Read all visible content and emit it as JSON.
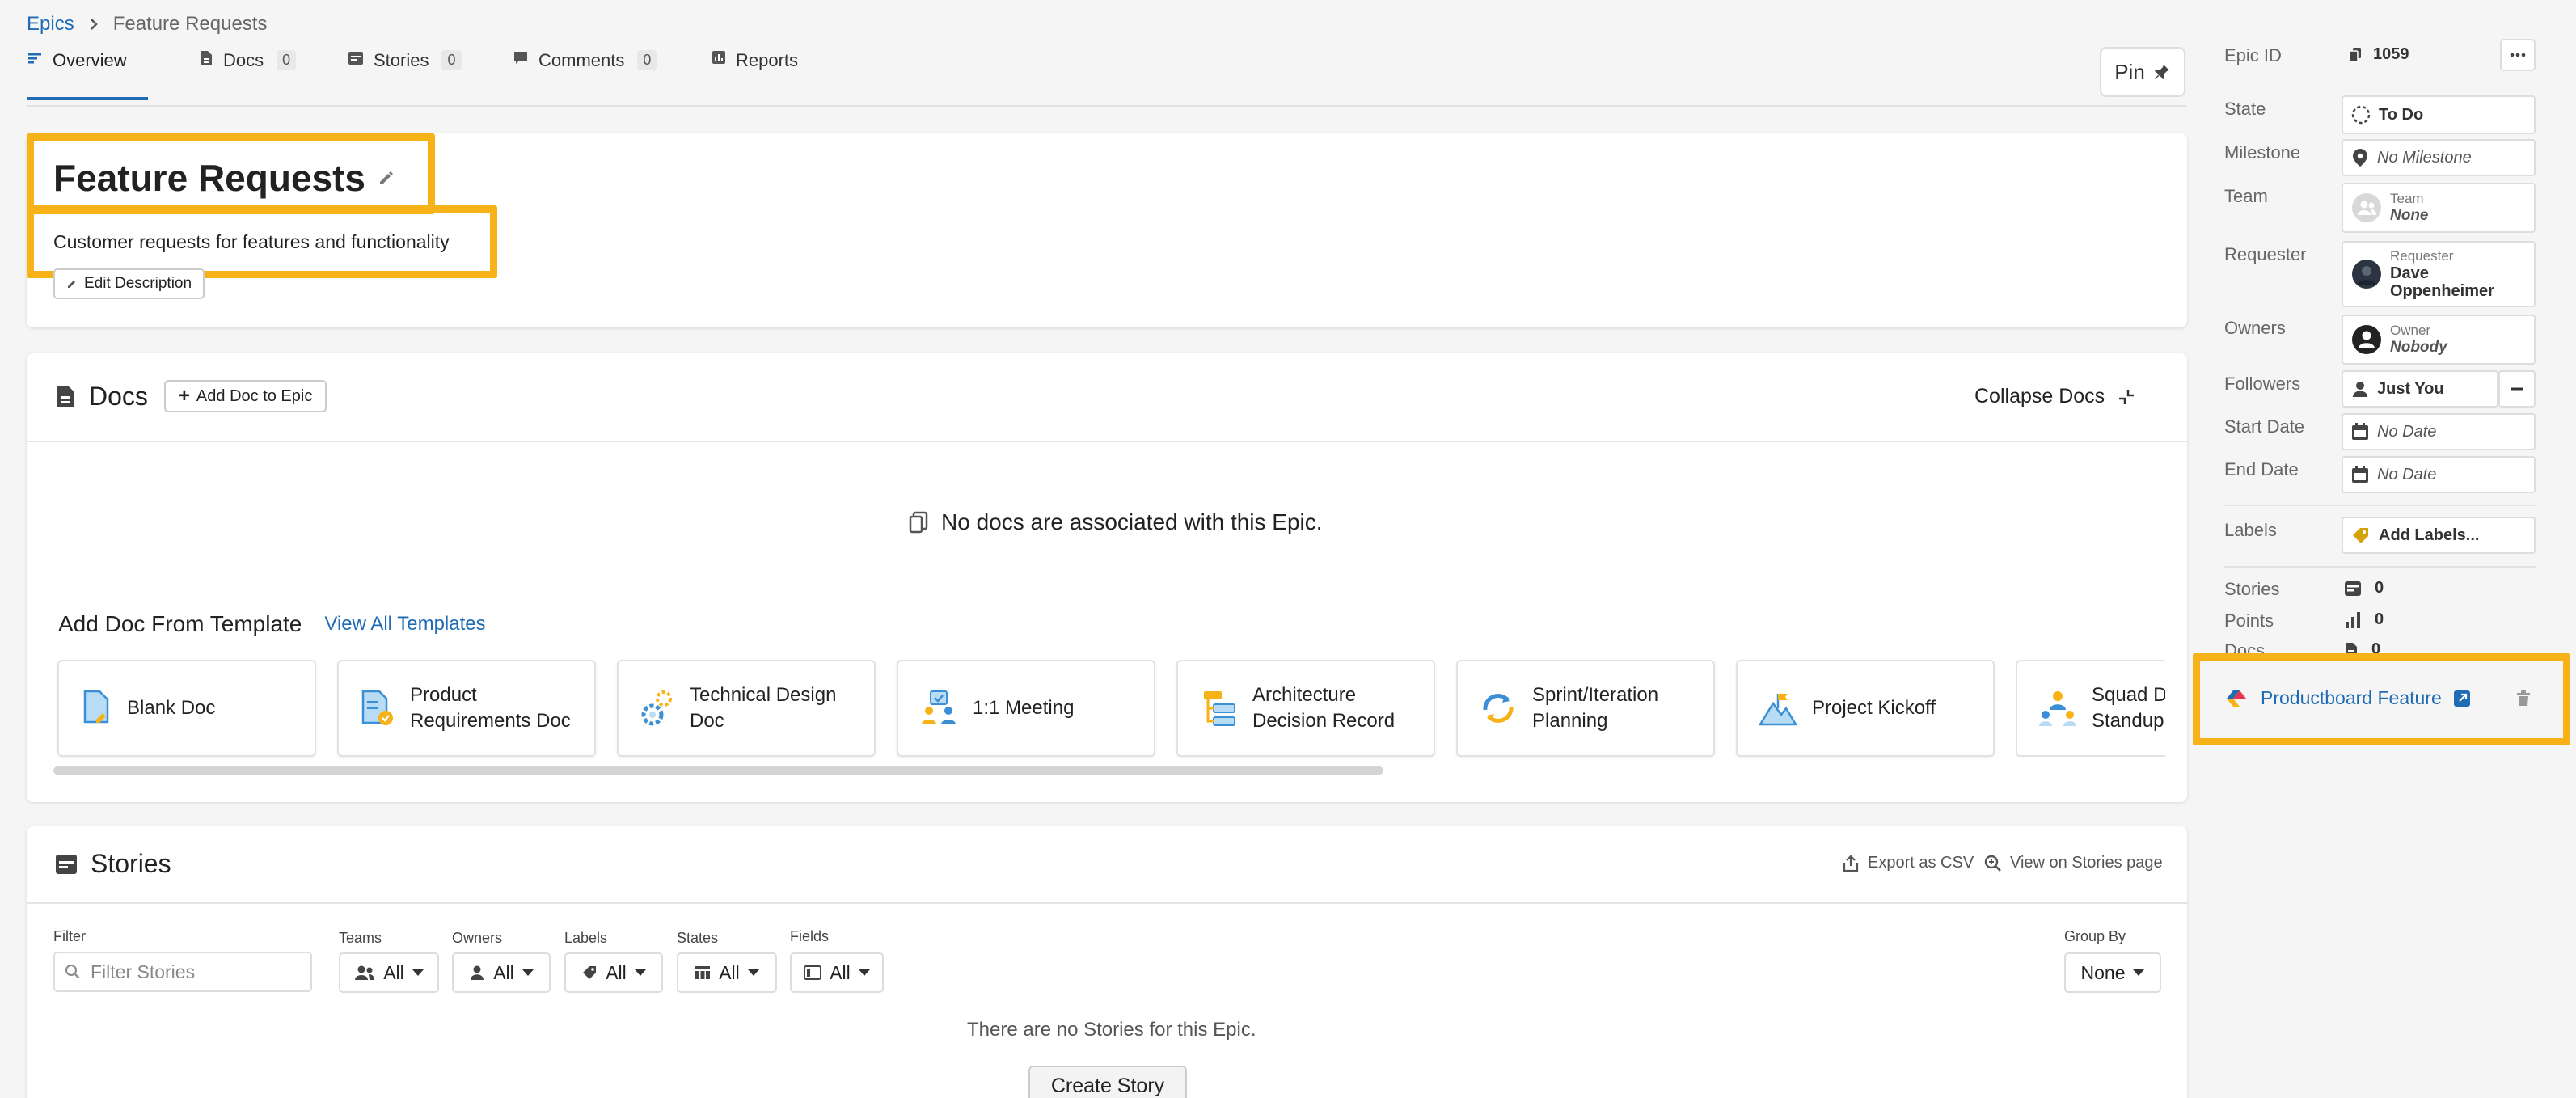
{
  "breadcrumb": {
    "parent": "Epics",
    "current": "Feature Requests"
  },
  "tabs": [
    {
      "label": "Overview"
    },
    {
      "label": "Docs",
      "count": "0"
    },
    {
      "label": "Stories",
      "count": "0"
    },
    {
      "label": "Comments",
      "count": "0"
    },
    {
      "label": "Reports"
    }
  ],
  "pin_label": "Pin",
  "epic": {
    "title": "Feature Requests",
    "description": "Customer requests for features and functionality",
    "edit_description": "Edit Description"
  },
  "docs": {
    "title": "Docs",
    "add_doc": "Add Doc to Epic",
    "collapse": "Collapse Docs",
    "empty": "No docs are associated with this Epic.",
    "template_heading": "Add Doc From Template",
    "view_all": "View All Templates",
    "templates": [
      {
        "line1": "Blank Doc",
        "line2": ""
      },
      {
        "line1": "Product",
        "line2": "Requirements Doc"
      },
      {
        "line1": "Technical Design",
        "line2": "Doc"
      },
      {
        "line1": "1:1 Meeting",
        "line2": ""
      },
      {
        "line1": "Architecture",
        "line2": "Decision Record"
      },
      {
        "line1": "Sprint/Iteration",
        "line2": "Planning"
      },
      {
        "line1": "Project Kickoff",
        "line2": ""
      },
      {
        "line1": "Squad Da",
        "line2": "Standup"
      }
    ]
  },
  "stories": {
    "title": "Stories",
    "export": "Export as CSV",
    "view_on_page": "View on Stories page",
    "filter_label": "Filter",
    "filter_placeholder": "Filter Stories",
    "teams_label": "Teams",
    "teams_value": "All",
    "owners_label": "Owners",
    "owners_value": "All",
    "labels_label": "Labels",
    "labels_value": "All",
    "states_label": "States",
    "states_value": "All",
    "fields_label": "Fields",
    "fields_value": "All",
    "groupby_label": "Group By",
    "groupby_value": "None",
    "empty": "There are no Stories for this Epic.",
    "create": "Create Story"
  },
  "sidebar": {
    "epic_id_label": "Epic ID",
    "epic_id": "1059",
    "state_label": "State",
    "state_value": "To Do",
    "milestone_label": "Milestone",
    "milestone_value": "No Milestone",
    "team_label": "Team",
    "team_sub": "Team",
    "team_value": "None",
    "requester_label": "Requester",
    "requester_sub": "Requester",
    "requester_value_1": "Dave",
    "requester_value_2": "Oppenheimer",
    "owners_label": "Owners",
    "owner_sub": "Owner",
    "owner_value": "Nobody",
    "followers_label": "Followers",
    "followers_value": "Just You",
    "start_label": "Start Date",
    "start_value": "No Date",
    "end_label": "End Date",
    "end_value": "No Date",
    "labels_label": "Labels",
    "labels_value": "Add Labels...",
    "stories_label": "Stories",
    "stories_value": "0",
    "points_label": "Points",
    "points_value": "0",
    "docs_label": "Docs",
    "docs_value": "0",
    "integration_label": "Productboard Feature"
  },
  "colors": {
    "accent": "#1f6cb5",
    "highlight": "#f7b217"
  }
}
